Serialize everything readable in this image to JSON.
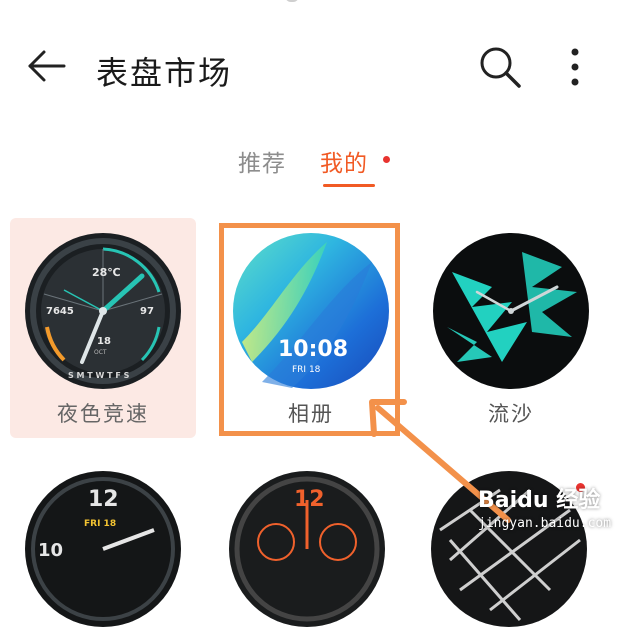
{
  "header": {
    "title": "表盘市场",
    "back_icon": "back-arrow-icon",
    "search_icon": "search-icon",
    "more_icon": "more-vertical-icon"
  },
  "tabs": [
    {
      "label": "推荐",
      "active": false
    },
    {
      "label": "我的",
      "active": true,
      "has_badge": true
    }
  ],
  "colors": {
    "accent": "#f15a24",
    "badge": "#e8332f",
    "selected_card_bg": "#fce9e4",
    "annotation": "#f3914a"
  },
  "watch_faces": [
    {
      "label": "夜色竞速",
      "selected": true,
      "face": {
        "temp": "28℃",
        "steps": "7645",
        "heart": "97",
        "date": "18",
        "month": "OCT",
        "weekdays": "S M T W T F S"
      }
    },
    {
      "label": "相册",
      "highlighted": true,
      "face": {
        "time": "10:08",
        "date": "FRI 18"
      }
    },
    {
      "label": "流沙"
    }
  ],
  "second_row": [
    {
      "face": {
        "numeral_top": "12",
        "numeral_left": "10",
        "date": "FRI 18"
      }
    },
    {
      "face": {
        "numeral_top": "12"
      }
    },
    {
      "face": {},
      "has_new_badge": true
    }
  ],
  "watermark": {
    "brand": "Baidu 经验",
    "url": "jingyan.baidu.com"
  }
}
